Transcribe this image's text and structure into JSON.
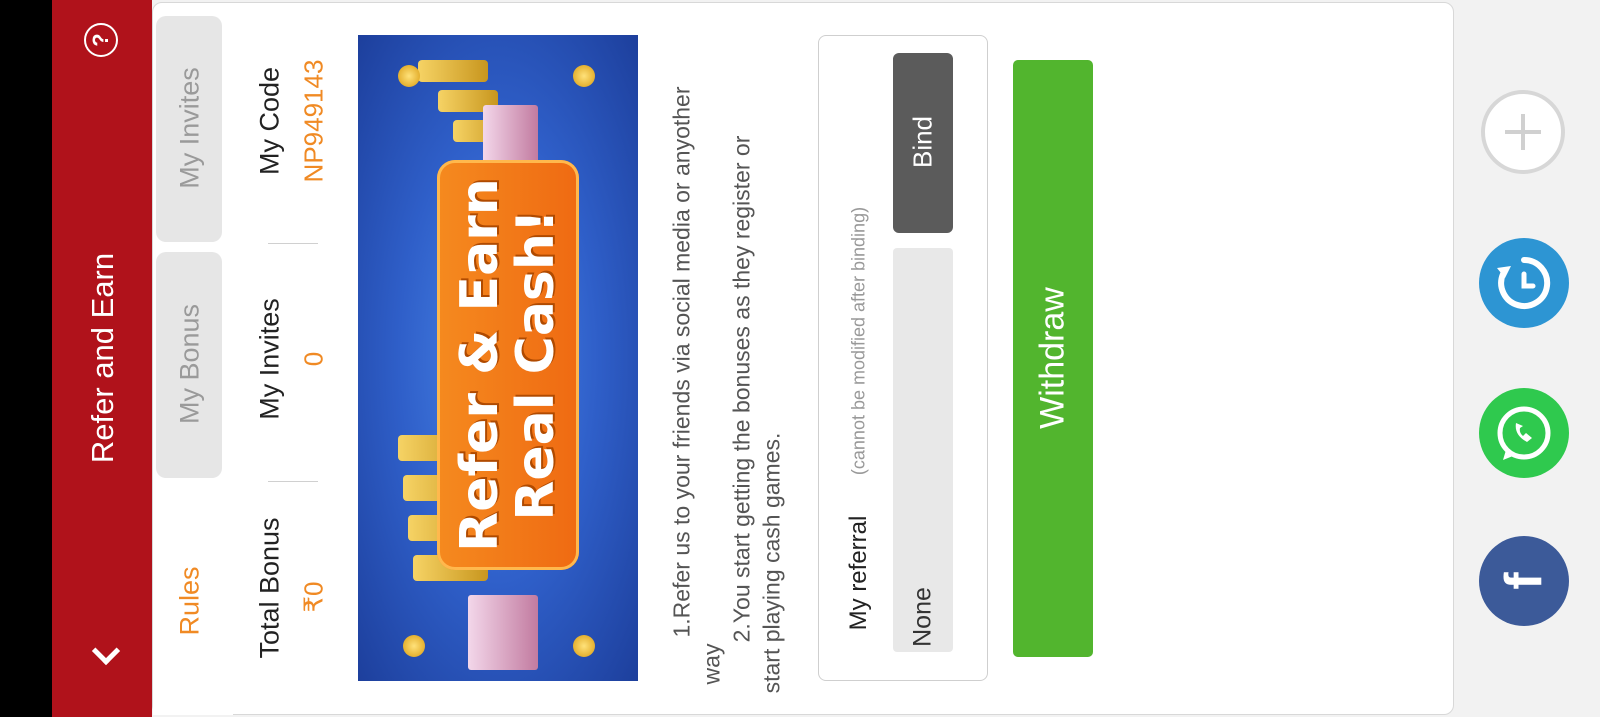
{
  "header": {
    "title": "Refer and Earn"
  },
  "tabs": [
    {
      "label": "Rules",
      "active": true
    },
    {
      "label": "My Bonus",
      "active": false
    },
    {
      "label": "My Invites",
      "active": false
    }
  ],
  "stats": {
    "total_bonus_label": "Total Bonus",
    "total_bonus_value": "₹0",
    "invites_label": "My Invites",
    "invites_value": "0",
    "code_label": "My Code",
    "code_value": "NP949143"
  },
  "banner": {
    "line1": "Refer & Earn",
    "line2": "Real Cash!"
  },
  "rules": {
    "rule1_a": "1.Refer us to your friends via social media or anyother",
    "rule1_b": "way",
    "rule2_a": "2.You start getting the bonuses as they register or",
    "rule2_b": "start playing cash games."
  },
  "referral": {
    "label": "My referral",
    "note": "(cannot be modified after binding)",
    "value": "None",
    "bind_label": "Bind"
  },
  "withdraw_label": "Withdraw",
  "colors": {
    "header": "#b0121b",
    "accent_orange": "#f08a24",
    "withdraw_green": "#52b52e",
    "bind_gray": "#5b5b5b"
  },
  "social_icons": [
    "plus-icon",
    "refresh-icon",
    "whatsapp-icon",
    "facebook-icon"
  ]
}
